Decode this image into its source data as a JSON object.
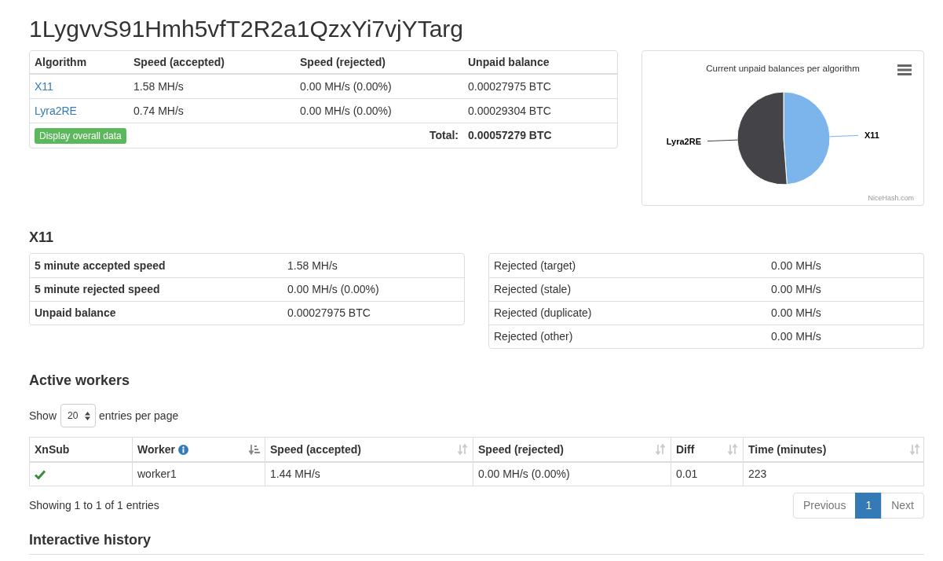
{
  "page_title": "1LygvvS91Hmh5vfT2R2a1QzxYi7vjYTarg",
  "algorithms_table": {
    "columns": [
      "Algorithm",
      "Speed (accepted)",
      "Speed (rejected)",
      "Unpaid balance"
    ],
    "rows": [
      {
        "algorithm": "X11",
        "speed_accepted": "1.58 MH/s",
        "speed_rejected": "0.00 MH/s (0.00%)",
        "unpaid_balance": "0.00027975 BTC"
      },
      {
        "algorithm": "Lyra2RE",
        "speed_accepted": "0.74 MH/s",
        "speed_rejected": "0.00 MH/s (0.00%)",
        "unpaid_balance": "0.00029304 BTC"
      }
    ],
    "footer": {
      "button": "Display overall data",
      "total_label": "Total:",
      "total_value": "0.00057279 BTC"
    }
  },
  "balance_chart": {
    "credit": "NiceHash.com",
    "chart_data": {
      "type": "pie",
      "title": "Current unpaid balances per algorithm",
      "categories": [
        "X11",
        "Lyra2RE"
      ],
      "values": [
        48.84,
        51.16
      ]
    }
  },
  "algorithm_detail": {
    "heading": "X11",
    "summary": [
      {
        "label": "5 minute accepted speed",
        "value": "1.58 MH/s"
      },
      {
        "label": "5 minute rejected speed",
        "value": "0.00 MH/s (0.00%)"
      },
      {
        "label": "Unpaid balance",
        "value": "0.00027975 BTC"
      }
    ],
    "rejections": [
      {
        "label": "Rejected (target)",
        "value": "0.00 MH/s"
      },
      {
        "label": "Rejected (stale)",
        "value": "0.00 MH/s"
      },
      {
        "label": "Rejected (duplicate)",
        "value": "0.00 MH/s"
      },
      {
        "label": "Rejected (other)",
        "value": "0.00 MH/s"
      }
    ]
  },
  "active_workers": {
    "heading": "Active workers",
    "show_label": "Show",
    "page_size": "20",
    "per_page_label": "entries per page",
    "columns": [
      {
        "label": "XnSub",
        "sortable": false,
        "sorted": false,
        "info": false
      },
      {
        "label": "Worker",
        "sortable": true,
        "sorted": true,
        "info": true
      },
      {
        "label": "Speed (accepted)",
        "sortable": true,
        "sorted": false,
        "info": false
      },
      {
        "label": "Speed (rejected)",
        "sortable": true,
        "sorted": false,
        "info": false
      },
      {
        "label": "Diff",
        "sortable": true,
        "sorted": false,
        "info": false
      },
      {
        "label": "Time (minutes)",
        "sortable": true,
        "sorted": false,
        "info": false
      }
    ],
    "rows": [
      {
        "xnsub": true,
        "worker": "worker1",
        "speed_accepted": "1.44 MH/s",
        "speed_rejected": "0.00 MH/s (0.00%)",
        "diff": "0.01",
        "time_minutes": "223"
      }
    ],
    "info": "Showing 1 to 1 of 1 entries",
    "pagination": [
      {
        "label": "Previous",
        "selected": false,
        "disabled": true
      },
      {
        "label": "1",
        "selected": true,
        "disabled": false
      },
      {
        "label": "Next",
        "selected": false,
        "disabled": true
      }
    ]
  },
  "interactive_history": {
    "heading": "Interactive history"
  }
}
